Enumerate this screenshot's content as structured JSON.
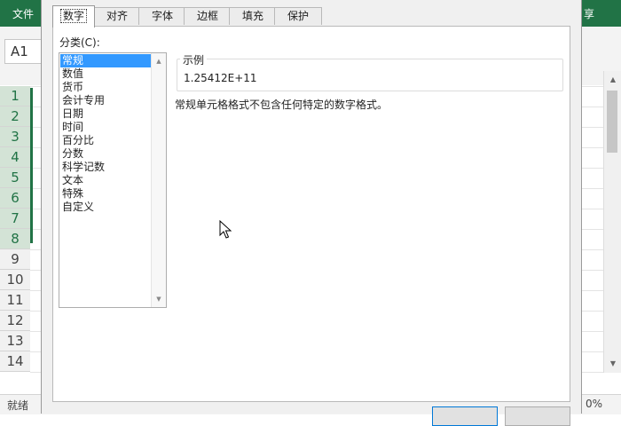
{
  "excel": {
    "ribbon": {
      "file_tab": "文件",
      "share_tab": "享"
    },
    "name_box": "A1",
    "row_headers": [
      "1",
      "2",
      "3",
      "4",
      "5",
      "6",
      "7",
      "8",
      "9",
      "10",
      "11",
      "12",
      "13",
      "14"
    ],
    "selected_rows": 8,
    "status_bar": {
      "ready": "就绪",
      "zoom": "0%"
    }
  },
  "dialog": {
    "tabs": [
      {
        "label": "数字",
        "active": true
      },
      {
        "label": "对齐",
        "active": false
      },
      {
        "label": "字体",
        "active": false
      },
      {
        "label": "边框",
        "active": false
      },
      {
        "label": "填充",
        "active": false
      },
      {
        "label": "保护",
        "active": false
      }
    ],
    "category_label": "分类(C):",
    "categories": [
      "常规",
      "数值",
      "货币",
      "会计专用",
      "日期",
      "时间",
      "百分比",
      "分数",
      "科学记数",
      "文本",
      "特殊",
      "自定义"
    ],
    "selected_category": "常规",
    "sample_label": "示例",
    "sample_value": "1.25412E+11",
    "description": "常规单元格格式不包含任何特定的数字格式。"
  },
  "colors": {
    "excel_green": "#217346",
    "selection_blue": "#3399ff",
    "dialog_bg": "#f0f0f0"
  },
  "icons": [
    "scroll-up-arrow-icon",
    "scroll-down-arrow-icon",
    "mouse-cursor-icon"
  ]
}
